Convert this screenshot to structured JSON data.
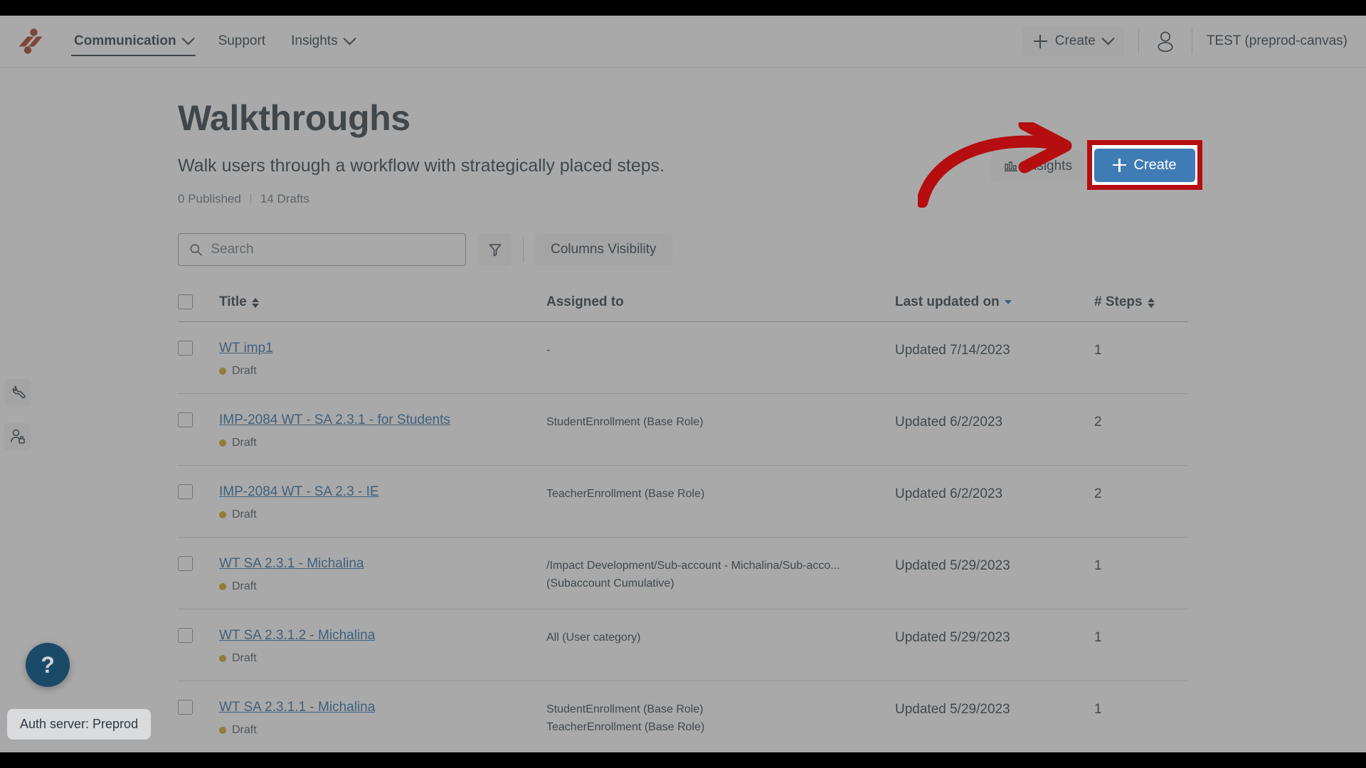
{
  "colors": {
    "brand_red": "#a33a21",
    "link_blue": "#2b6da8",
    "create_button_blue": "#3f7cb6",
    "annotation_red": "#b50d10",
    "draft_dot_amber": "#c9a81b",
    "help_fab_navy": "#1b4a69",
    "text_primary": "#2d3b45"
  },
  "topnav": {
    "logo_name": "impact-logo",
    "items": [
      {
        "label": "Communication",
        "has_chevron": true,
        "active": true,
        "name": "nav-item-communication"
      },
      {
        "label": "Support",
        "has_chevron": false,
        "active": false,
        "name": "nav-item-support"
      },
      {
        "label": "Insights",
        "has_chevron": true,
        "active": false,
        "name": "nav-item-insights"
      }
    ],
    "create_label": "Create",
    "account_label": "TEST (preprod-canvas)",
    "avatar_icon": "user-icon",
    "plus_icon": "plus-icon",
    "chevron_icon": "chevron-down-icon"
  },
  "left_rail": [
    {
      "icon": "wrench-icon",
      "name": "rail-button-tools"
    },
    {
      "icon": "user-lock-icon",
      "name": "rail-button-permissions"
    }
  ],
  "page": {
    "title": "Walkthroughs",
    "subtitle": "Walk users through a workflow with strategically placed steps.",
    "published_count": "0 Published",
    "drafts_count": "14 Drafts"
  },
  "header_actions": {
    "insights_label": "Insights",
    "insights_icon": "bar-chart-icon",
    "create_label": "Create",
    "create_icon": "plus-icon"
  },
  "annotation": {
    "type": "red-highlight-box-with-arrow",
    "target": "create-button",
    "arrow_icon": "curved-arrow-icon"
  },
  "toolbar": {
    "search_placeholder": "Search",
    "search_value": "",
    "search_icon": "search-icon",
    "filter_icon": "filter-funnel-icon",
    "columns_label": "Columns Visibility"
  },
  "table": {
    "columns": [
      {
        "label": "Title",
        "sortable": true,
        "sort": "none",
        "name": "column-header-title"
      },
      {
        "label": "Assigned to",
        "sortable": false,
        "sort": "none",
        "name": "column-header-assigned-to"
      },
      {
        "label": "Last updated on",
        "sortable": true,
        "sort": "desc",
        "name": "column-header-last-updated"
      },
      {
        "label": "# Steps",
        "sortable": true,
        "sort": "none",
        "name": "column-header-steps"
      }
    ],
    "rows": [
      {
        "title": "WT imp1",
        "status": "Draft",
        "assigned_to": [
          "-"
        ],
        "last_updated": "Updated 7/14/2023",
        "steps": "1"
      },
      {
        "title": "IMP-2084 WT - SA 2.3.1 - for Students",
        "status": "Draft",
        "assigned_to": [
          "StudentEnrollment (Base Role)"
        ],
        "last_updated": "Updated 6/2/2023",
        "steps": "2"
      },
      {
        "title": "IMP-2084 WT - SA 2.3 - IE",
        "status": "Draft",
        "assigned_to": [
          "TeacherEnrollment (Base Role)"
        ],
        "last_updated": "Updated 6/2/2023",
        "steps": "2"
      },
      {
        "title": "WT SA 2.3.1 - Michalina",
        "status": "Draft",
        "assigned_to": [
          "/Impact Development/Sub-account - Michalina/Sub-acco...",
          "(Subaccount Cumulative)"
        ],
        "last_updated": "Updated 5/29/2023",
        "steps": "1"
      },
      {
        "title": "WT SA 2.3.1.2 - Michalina",
        "status": "Draft",
        "assigned_to": [
          "All (User category)"
        ],
        "last_updated": "Updated 5/29/2023",
        "steps": "1"
      },
      {
        "title": "WT SA 2.3.1.1 - Michalina",
        "status": "Draft",
        "assigned_to": [
          "StudentEnrollment (Base Role)",
          "TeacherEnrollment (Base Role)"
        ],
        "last_updated": "Updated 5/29/2023",
        "steps": "1"
      }
    ]
  },
  "floating": {
    "help_label": "?",
    "auth_badge": "Auth server: Preprod"
  }
}
